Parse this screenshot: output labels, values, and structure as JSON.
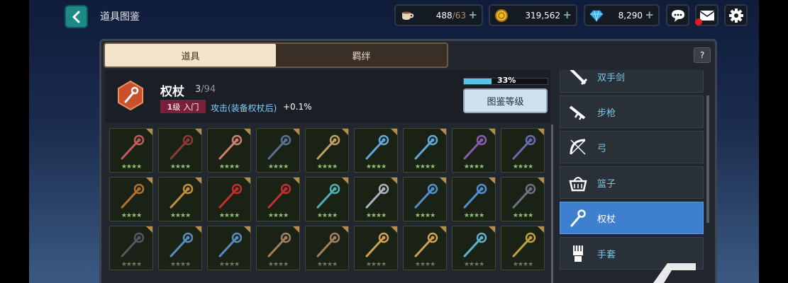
{
  "header": {
    "title": "道具图鉴",
    "back_icon": "chevron-left-icon"
  },
  "resources": {
    "stamina": {
      "icon": "cup-icon",
      "current": "488",
      "max": "/63"
    },
    "gold": {
      "icon": "coin-icon",
      "value": "319,562"
    },
    "gems": {
      "icon": "diamond-icon",
      "value": "8,290"
    },
    "plus_label": "+"
  },
  "top_buttons": [
    "chat-icon",
    "mail-icon",
    "settings-icon"
  ],
  "tabs": [
    {
      "label": "道具",
      "active": true
    },
    {
      "label": "羁绊",
      "active": false
    }
  ],
  "help_label": "?",
  "item_info": {
    "icon": "scepter-icon",
    "name": "权杖",
    "count_current": "3",
    "count_total": "/94",
    "level_number": "1",
    "level_unit": "级",
    "level_rank": "入门",
    "bonus_text": "攻击(装备权杖后)",
    "bonus_value": "+0.1%"
  },
  "collection": {
    "progress_percent": 33,
    "progress_label": "33%",
    "grade_button": "图鉴等级"
  },
  "grid": {
    "star_glyph": "★★★★",
    "rows": [
      [
        "#c25a5a",
        "#8a3a3a",
        "#d08070",
        "#5a7090",
        "#c0a060",
        "#5fa8d8",
        "#5fa8d8",
        "#8a5ab0",
        "#6a6ab0"
      ],
      [
        "#b07030",
        "#c09040",
        "#c03030",
        "#c03030",
        "#50b0b0",
        "#b0b0c0",
        "#5090d0",
        "#5090d0",
        "#707080"
      ],
      [
        "#505a60",
        "#5a8ac0",
        "#5a8ac0",
        "#a08060",
        "#a08060",
        "#d0a050",
        "#d0a050",
        "#60b0d0",
        "#c0a040"
      ]
    ]
  },
  "categories": [
    {
      "icon": "two-hand-sword-icon",
      "label": "双手剑",
      "active": false
    },
    {
      "icon": "rifle-icon",
      "label": "步枪",
      "active": false
    },
    {
      "icon": "bow-icon",
      "label": "弓",
      "active": false
    },
    {
      "icon": "basket-icon",
      "label": "篮子",
      "active": false
    },
    {
      "icon": "scepter-icon",
      "label": "权杖",
      "active": true
    },
    {
      "icon": "gauntlet-icon",
      "label": "手套",
      "active": false
    }
  ],
  "colors": {
    "accent_blue": "#3e7fcf",
    "panel_dark": "#22262e",
    "tab_active": "#f5e4cc",
    "level_badge": "#7a1f3a",
    "progress_fill": "#56c6e6",
    "star_collected": "#8fc26a",
    "star_empty": "#7a7560"
  }
}
